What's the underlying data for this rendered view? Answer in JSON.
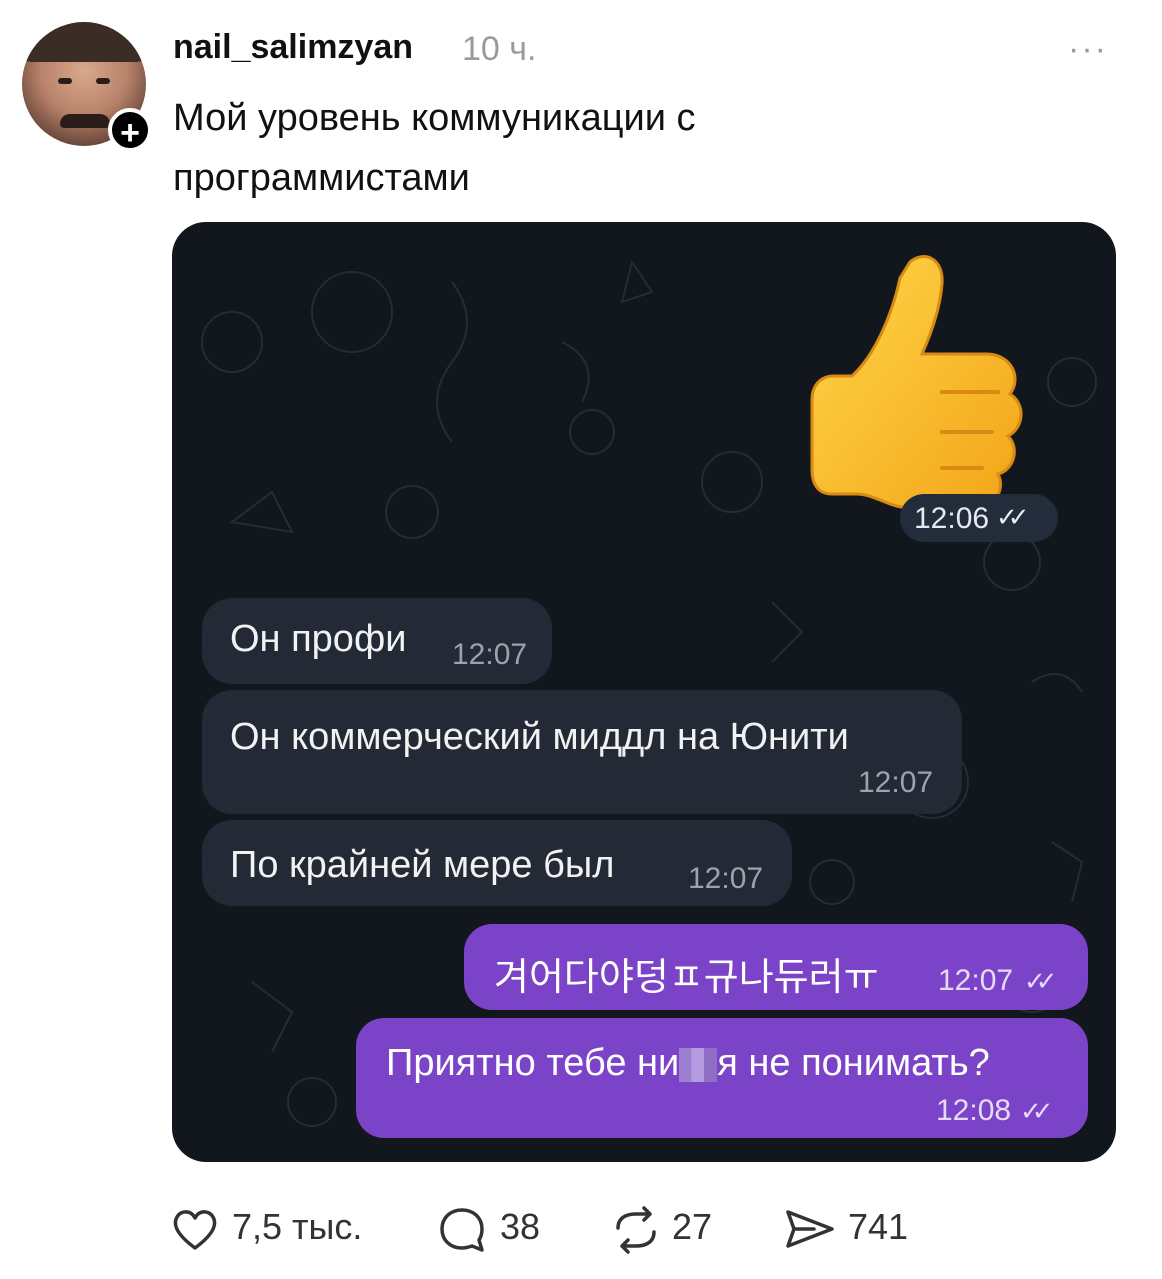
{
  "post": {
    "username": "nail_salimzyan",
    "time": "10 ч.",
    "more_label": "···",
    "follow_label": "+",
    "text": "Мой уровень коммуникации с программистами"
  },
  "chat": {
    "sticker": {
      "emoji_name": "thumbs-up",
      "time": "12:06",
      "read_mark": "✓✓"
    },
    "incoming": [
      {
        "text": "Он профи",
        "time": "12:07"
      },
      {
        "text": "Он коммерческий миддл на Юнити",
        "time": "12:07"
      },
      {
        "text": "По крайней мере был",
        "time": "12:07"
      }
    ],
    "outgoing": [
      {
        "text": "겨어다야덩ㅍ규나듀러ㅠ",
        "time": "12:07",
        "read_mark": "✓✓"
      },
      {
        "text_before": "Приятно тебе ни",
        "text_after": "я не понимать?",
        "time": "12:08",
        "read_mark": "✓✓"
      }
    ],
    "colors": {
      "background": "#12161d",
      "incoming_bubble": "#232a35",
      "outgoing_bubble": "#7b44c8"
    }
  },
  "actions": {
    "likes": "7,5 тыс.",
    "comments": "38",
    "reposts": "27",
    "shares": "741"
  }
}
